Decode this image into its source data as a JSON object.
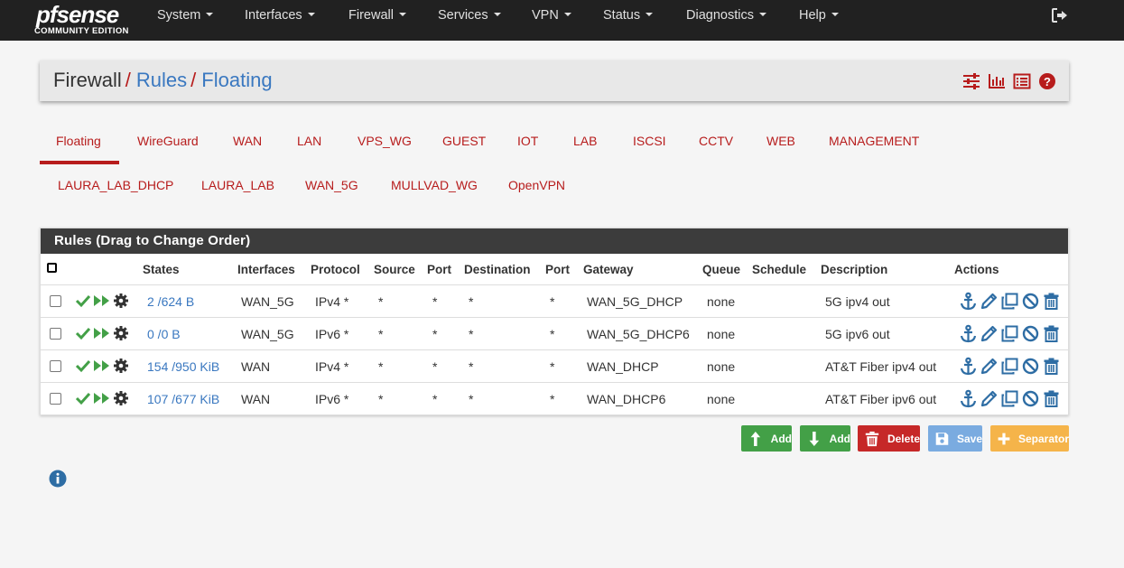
{
  "brand": {
    "logo_text": "pfsense",
    "edition": "COMMUNITY EDITION"
  },
  "nav": [
    {
      "label": "System"
    },
    {
      "label": "Interfaces"
    },
    {
      "label": "Firewall"
    },
    {
      "label": "Services"
    },
    {
      "label": "VPN"
    },
    {
      "label": "Status"
    },
    {
      "label": "Diagnostics"
    },
    {
      "label": "Help"
    }
  ],
  "breadcrumb": {
    "root": "Firewall",
    "level1": "Rules",
    "level2": "Floating"
  },
  "tabs_row1": [
    "Floating",
    "WireGuard",
    "WAN",
    "LAN",
    "VPS_WG",
    "GUEST",
    "IOT",
    "LAB",
    "ISCSI",
    "CCTV",
    "WEB",
    "MANAGEMENT"
  ],
  "tabs_row2": [
    "LAURA_LAB_DHCP",
    "LAURA_LAB",
    "WAN_5G",
    "MULLVAD_WG",
    "OpenVPN"
  ],
  "active_tab": "Floating",
  "rules_panel": {
    "title": "Rules (Drag to Change Order)",
    "columns": {
      "states": "States",
      "interfaces": "Interfaces",
      "protocol": "Protocol",
      "source": "Source",
      "sport": "Port",
      "destination": "Destination",
      "dport": "Port",
      "gateway": "Gateway",
      "queue": "Queue",
      "schedule": "Schedule",
      "description": "Description",
      "actions": "Actions"
    },
    "rows": [
      {
        "states": "2 /624 B",
        "interfaces": "WAN_5G",
        "protocol": "IPv4 *",
        "source": "*",
        "sport": "*",
        "destination": "*",
        "dport": "*",
        "gateway": "WAN_5G_DHCP",
        "queue": "none",
        "schedule": "",
        "description": "5G ipv4 out"
      },
      {
        "states": "0 /0 B",
        "interfaces": "WAN_5G",
        "protocol": "IPv6 *",
        "source": "*",
        "sport": "*",
        "destination": "*",
        "dport": "*",
        "gateway": "WAN_5G_DHCP6",
        "queue": "none",
        "schedule": "",
        "description": "5G ipv6 out"
      },
      {
        "states": "154 /950 KiB",
        "interfaces": "WAN",
        "protocol": "IPv4 *",
        "source": "*",
        "sport": "*",
        "destination": "*",
        "dport": "*",
        "gateway": "WAN_DHCP",
        "queue": "none",
        "schedule": "",
        "description": "AT&T Fiber ipv4 out"
      },
      {
        "states": "107 /677 KiB",
        "interfaces": "WAN",
        "protocol": "IPv6 *",
        "source": "*",
        "sport": "*",
        "destination": "*",
        "dport": "*",
        "gateway": "WAN_DHCP6",
        "queue": "none",
        "schedule": "",
        "description": "AT&T Fiber ipv6 out"
      }
    ]
  },
  "buttons": {
    "add_top": "Add",
    "add_bottom": "Add",
    "delete": "Delete",
    "save": "Save",
    "separator": "Separator"
  },
  "colors": {
    "navbar": "#212121",
    "accent_red": "#b71c1c",
    "link_blue": "#3a78c0",
    "success_green": "#43a047",
    "danger": "#c62828",
    "save_blue": "#7aabe0",
    "separator_orange": "#f5b44a"
  },
  "icons": {
    "row_status": [
      "check-icon",
      "fast-forward-icon",
      "gear-icon"
    ],
    "row_actions": [
      "anchor-icon",
      "pencil-icon",
      "copy-icon",
      "ban-icon",
      "trash-icon"
    ],
    "header": [
      "sliders-icon",
      "bar-chart-icon",
      "list-icon",
      "help-icon"
    ]
  }
}
